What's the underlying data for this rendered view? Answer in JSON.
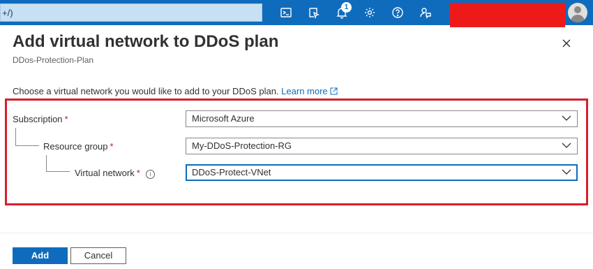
{
  "topbar": {
    "search_text": "+/)",
    "notification_count": "1",
    "icons": [
      "cloud-shell-icon",
      "directory-filter-icon",
      "bell-icon",
      "gear-icon",
      "help-icon",
      "feedback-icon"
    ],
    "accent_color": "#0f6cbd"
  },
  "header": {
    "title": "Add virtual network to DDoS plan",
    "subtitle": "DDos-Protection-Plan"
  },
  "intro": {
    "text": "Choose a virtual network you would like to add to your DDoS plan.",
    "link_label": "Learn more"
  },
  "form": {
    "subscription": {
      "label": "Subscription",
      "required_mark": "*",
      "value": "Microsoft Azure"
    },
    "resource_group": {
      "label": "Resource group",
      "required_mark": "*",
      "value": "My-DDoS-Protection-RG"
    },
    "virtual_network": {
      "label": "Virtual network",
      "required_mark": "*",
      "info": "i",
      "value": "DDoS-Protect-VNet"
    }
  },
  "footer": {
    "add_label": "Add",
    "cancel_label": "Cancel"
  },
  "highlight_color": "#d81e2b"
}
